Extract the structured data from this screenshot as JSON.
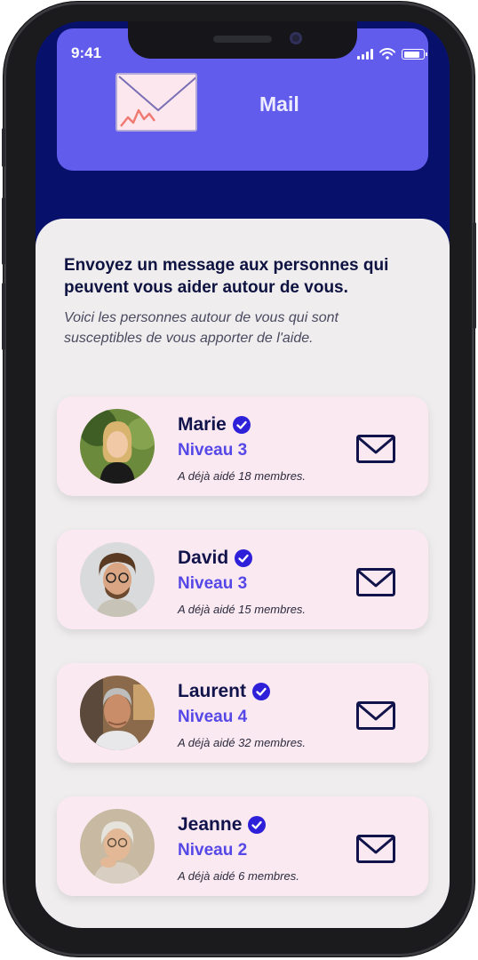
{
  "status": {
    "time": "9:41"
  },
  "header": {
    "title": "Mail",
    "logo_icon": "envelope-logo-icon"
  },
  "intro": {
    "headline": "Envoyez un message aux personnes qui peuvent vous aider autour de vous.",
    "subtext": "Voici les personnes autour de vous qui sont susceptibles de vous apporter de l'aide."
  },
  "helpers": [
    {
      "name": "Marie",
      "level": "Niveau 3",
      "helped": "A déjà aidé 18 membres.",
      "verified_icon": "verified-check-icon",
      "action_icon": "mail-icon"
    },
    {
      "name": "David",
      "level": "Niveau 3",
      "helped": "A déjà aidé 15 membres.",
      "verified_icon": "verified-check-icon",
      "action_icon": "mail-icon"
    },
    {
      "name": "Laurent",
      "level": "Niveau 4",
      "helped": "A déjà aidé 32 membres.",
      "verified_icon": "verified-check-icon",
      "action_icon": "mail-icon"
    },
    {
      "name": "Jeanne",
      "level": "Niveau 2",
      "helped": "A déjà aidé 6 membres.",
      "verified_icon": "verified-check-icon",
      "action_icon": "mail-icon"
    }
  ],
  "colors": {
    "background_dark": "#07106a",
    "header_card": "#625cec",
    "accent": "#5548e6",
    "card_bg": "#fbe9f2",
    "verified": "#2e1fd8"
  }
}
